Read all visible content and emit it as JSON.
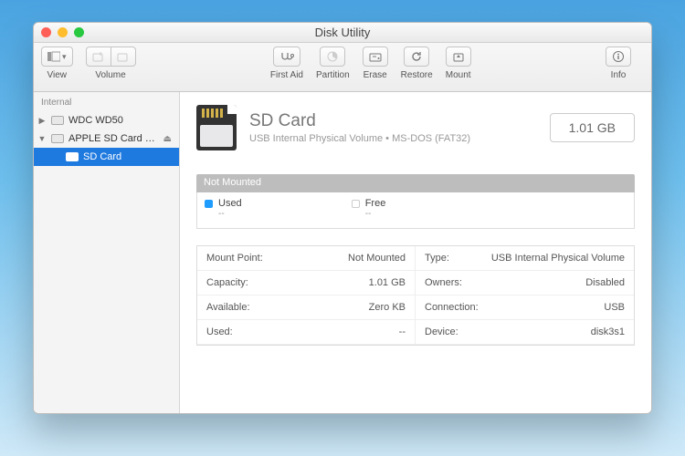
{
  "window": {
    "title": "Disk Utility"
  },
  "toolbar": {
    "view": "View",
    "volume": "Volume",
    "first_aid": "First Aid",
    "partition": "Partition",
    "erase": "Erase",
    "restore": "Restore",
    "mount": "Mount",
    "info": "Info"
  },
  "sidebar": {
    "section": "Internal",
    "items": [
      {
        "label": "WDC WD50"
      },
      {
        "label": "APPLE SD Card R..."
      },
      {
        "label": "SD Card"
      }
    ]
  },
  "volume": {
    "name": "SD Card",
    "subtitle": "USB Internal Physical Volume • MS-DOS (FAT32)",
    "capacity_badge": "1.01 GB",
    "status": "Not Mounted",
    "used_label": "Used",
    "used_value": "--",
    "free_label": "Free",
    "free_value": "--"
  },
  "details": {
    "mount_point_k": "Mount Point:",
    "mount_point_v": "Not Mounted",
    "type_k": "Type:",
    "type_v": "USB Internal Physical Volume",
    "capacity_k": "Capacity:",
    "capacity_v": "1.01 GB",
    "owners_k": "Owners:",
    "owners_v": "Disabled",
    "available_k": "Available:",
    "available_v": "Zero KB",
    "connection_k": "Connection:",
    "connection_v": "USB",
    "used_k": "Used:",
    "used_v": "--",
    "device_k": "Device:",
    "device_v": "disk3s1"
  }
}
